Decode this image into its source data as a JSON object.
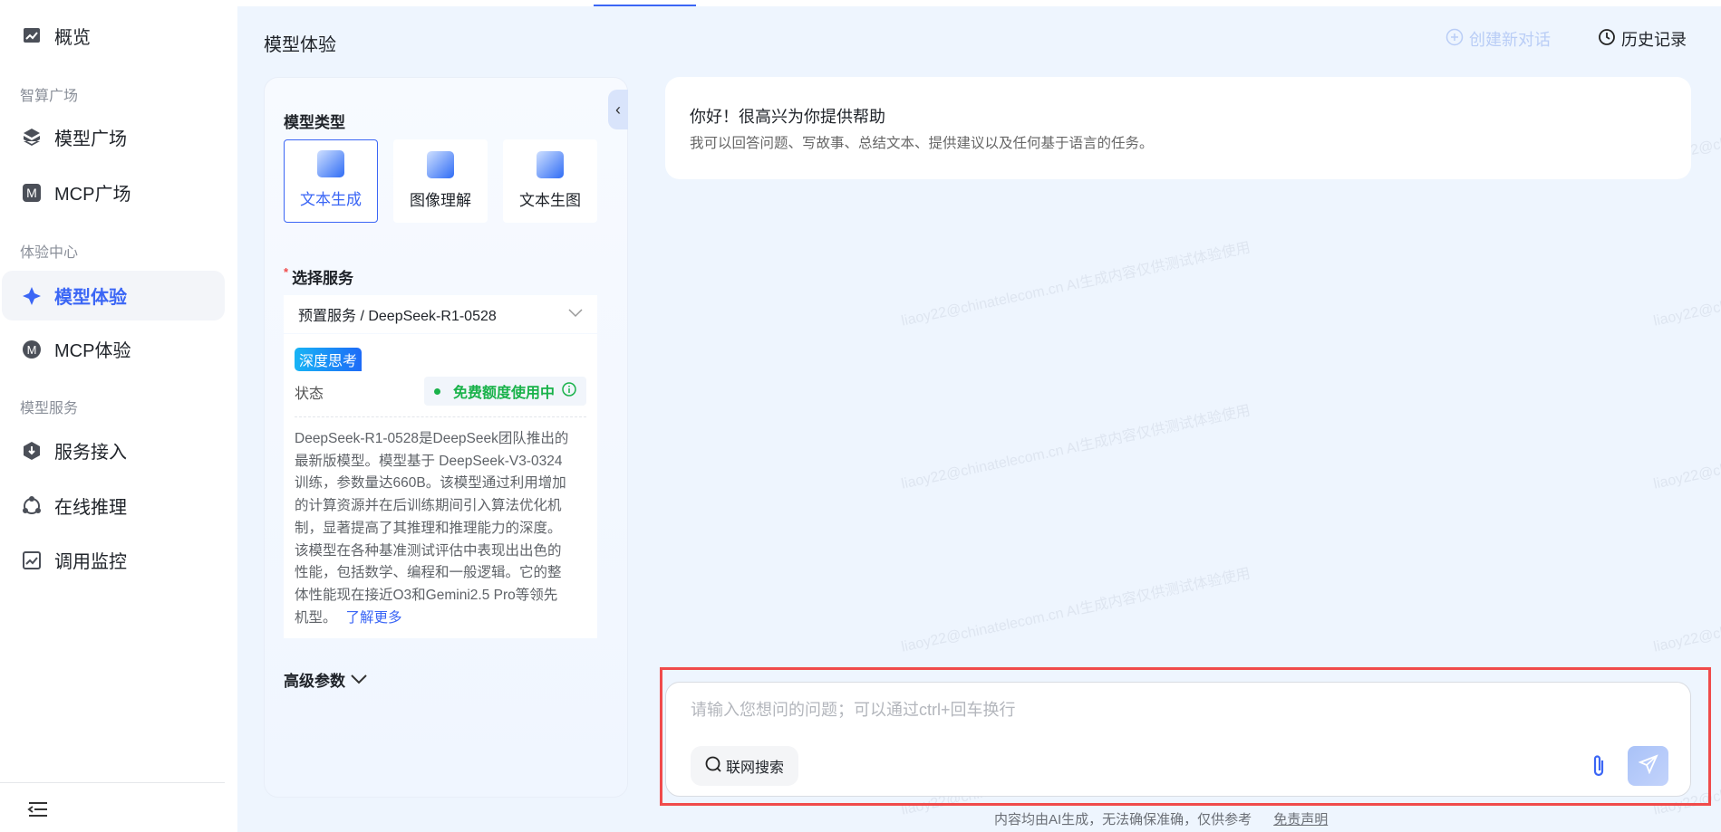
{
  "sidebar": {
    "items": [
      {
        "label": "概览",
        "icon": "chart-icon"
      },
      {
        "label": "模型广场",
        "icon": "cube-icon"
      },
      {
        "label": "MCP广场",
        "icon": "mcp-square-icon"
      },
      {
        "label": "模型体验",
        "icon": "sparkle-icon"
      },
      {
        "label": "MCP体验",
        "icon": "mcp-circle-icon"
      },
      {
        "label": "服务接入",
        "icon": "service-icon"
      },
      {
        "label": "在线推理",
        "icon": "inference-icon"
      },
      {
        "label": "调用监控",
        "icon": "monitor-icon"
      }
    ],
    "groups": [
      "智算广场",
      "体验中心",
      "模型服务"
    ],
    "active": "模型体验"
  },
  "page": {
    "title": "模型体验"
  },
  "panel": {
    "model_type_label": "模型类型",
    "types": [
      "文本生成",
      "图像理解",
      "文本生图"
    ],
    "select_service_label": "选择服务",
    "required_mark": "*",
    "service_value": "预置服务 / DeepSeek-R1-0528",
    "tag": "深度思考",
    "state_label": "状态",
    "state_value": "免费额度使用中",
    "description_lines": [
      "DeepSeek-R1-0528是DeepSeek团队推出的",
      "最新版模型。模型基于 DeepSeek-V3-0324",
      "训练，参数量达660B。该模型通过利用增加",
      "的计算资源并在后训练期间引入算法优化机",
      "制，显著提高了其推理和推理能力的深度。",
      "该模型在各种基准测试评估中表现出出色的",
      "性能，包括数学、编程和一般逻辑。它的整",
      "体性能现在接近O3和Gemini2.5 Pro等领先",
      "机型。"
    ],
    "learn_more": "了解更多",
    "advanced_label": "高级参数"
  },
  "header": {
    "new_chat": "创建新对话",
    "history": "历史记录"
  },
  "chat": {
    "greeting": "你好！很高兴为你提供帮助",
    "subtitle": "我可以回答问题、写故事、总结文本、提供建议以及任何基于语言的任务。"
  },
  "input": {
    "placeholder": "请输入您想问的问题；可以通过ctrl+回车换行",
    "web_search": "联网搜索"
  },
  "footer": {
    "notice": "内容均由AI生成，无法确保准确，仅供参考",
    "disclaimer": "免责声明"
  },
  "watermark": "liaoy22@chinatelecom.cn AI生成内容仅供测试体验使用",
  "colors": {
    "accent": "#3b66f5",
    "success": "#19b24a",
    "highlight_border": "#f04b4b"
  }
}
